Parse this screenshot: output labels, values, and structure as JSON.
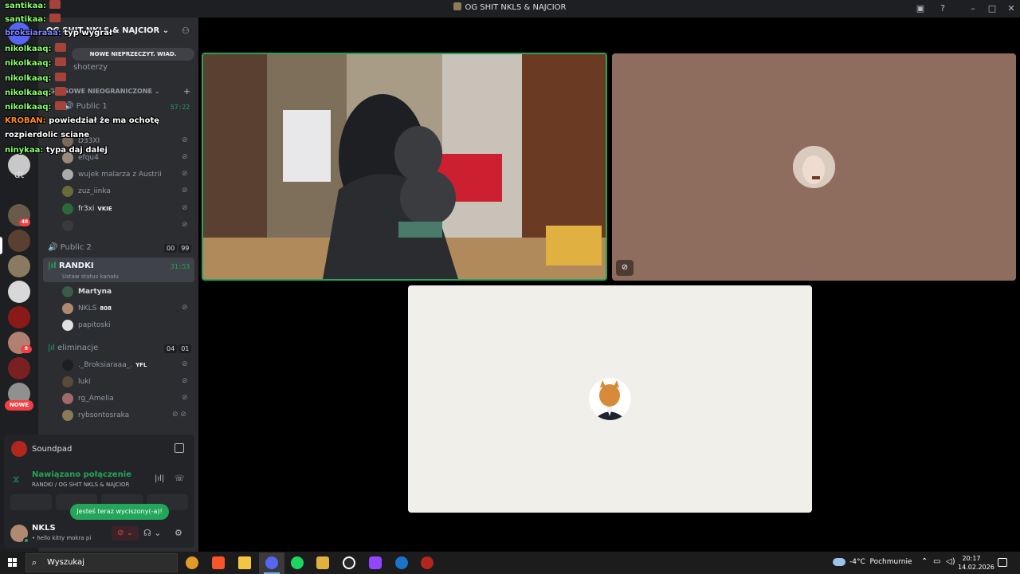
{
  "window": {
    "title": "OG SHIT NKLS & NAJCIOR"
  },
  "rail": {
    "folder_label": "dt",
    "new_badge": "NOWE",
    "badges": [
      "48",
      "43",
      "8"
    ]
  },
  "server": {
    "name": "OG SHIT NKLS & NAJCIOR",
    "unread_pill": "NOWE NIEPRZECZYT. WIAD.",
    "category": "GŁOSOWE NIEOGRANICZONE",
    "text_channel": "shoterzy",
    "channels": [
      {
        "name": "Public 1",
        "timer": "57:22",
        "users": [
          {
            "name": "D33XI"
          },
          {
            "name": "efqu4"
          },
          {
            "name": "wujek malarza z Austrii"
          },
          {
            "name": "zuz_iinka"
          },
          {
            "name": "fr3xi",
            "tag": "VKIE"
          },
          {
            "name": ""
          }
        ]
      },
      {
        "name": "Public 2",
        "counts": [
          "00",
          "99"
        ]
      },
      {
        "name": "RANDKI",
        "timer": "31:53",
        "status": "Ustaw status kanału",
        "users": [
          {
            "name": "Martyna"
          },
          {
            "name": "NKLS",
            "tag": "808"
          },
          {
            "name": "papitoski"
          }
        ]
      },
      {
        "name": "eliminacje",
        "counts": [
          "04",
          "01"
        ],
        "users": [
          {
            "name": "._Broksiaraaa_.",
            "tag": "YFL"
          },
          {
            "name": "luki"
          },
          {
            "name": "rg_Amelia"
          },
          {
            "name": "rybsontosraka"
          }
        ]
      }
    ]
  },
  "panel": {
    "soundpad": "Soundpad",
    "voice_status": "Nawiązano połączenie",
    "voice_location": "RANDKI / OG SHIT NKLS & NAJCIOR",
    "toast": "Jesteś teraz wyciszony(-a)!",
    "user_name": "NKLS",
    "user_status": "• hello kitty mokra pi"
  },
  "chat": [
    {
      "nick": "santikaa:",
      "msg": "",
      "color": "green"
    },
    {
      "nick": "santikaa:",
      "msg": "",
      "color": "green"
    },
    {
      "nick": "broksiaraaa:",
      "msg": "typ wygrał",
      "color": "blue"
    },
    {
      "nick": "nikolkaaq:",
      "msg": "",
      "color": "green"
    },
    {
      "nick": "nikolkaaq:",
      "msg": "",
      "color": "green"
    },
    {
      "nick": "nikolkaaq:",
      "msg": "",
      "color": "green"
    },
    {
      "nick": "nikolkaaq:",
      "msg": "",
      "color": "green"
    },
    {
      "nick": "nikolkaaq:",
      "msg": "",
      "color": "green"
    },
    {
      "nick": "KROBAN:",
      "msg": "powiedział że ma ochotę",
      "color": "orange"
    },
    {
      "nick": "",
      "msg": "rozpierdolic sciane",
      "color": "green"
    },
    {
      "nick": "ninykaa:",
      "msg": "typa daj dalej",
      "color": "green"
    }
  ],
  "taskbar": {
    "search_placeholder": "Wyszukaj",
    "temperature": "-4°C",
    "weather": "Pochmurnie",
    "time": "20:17",
    "date": "14.02.2026"
  }
}
